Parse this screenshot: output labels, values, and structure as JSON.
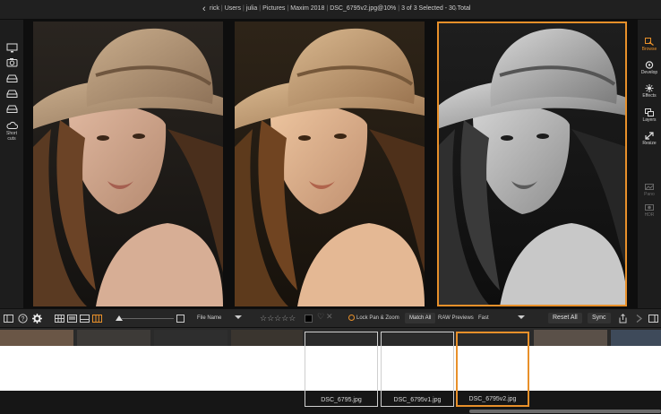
{
  "titlebar": {
    "back": "‹",
    "forward": "›",
    "crumbs": [
      "rick",
      "Users",
      "julia",
      "Pictures",
      "Maxim 2018",
      "DSC_6795v2.jpg@10%"
    ],
    "selection": "3 of 3 Selected - 30 Total"
  },
  "left_rail": {
    "icons": [
      "monitor-icon",
      "camera-icon",
      "drive-icon",
      "drive-icon",
      "drive-icon",
      "cloud-icon"
    ],
    "shortcuts_label": "Short cuts"
  },
  "right_rail": {
    "items": [
      {
        "label": "Browse",
        "icon": "browse-icon"
      },
      {
        "label": "Develop",
        "icon": "develop-icon"
      },
      {
        "label": "Effects",
        "icon": "effects-icon"
      },
      {
        "label": "Layers",
        "icon": "layers-icon"
      },
      {
        "label": "Resize",
        "icon": "resize-icon"
      },
      {
        "label": "Pano",
        "icon": "pano-icon"
      },
      {
        "label": "HDR",
        "icon": "hdr-icon"
      }
    ],
    "accent": "#e8902a"
  },
  "toolbar": {
    "sort_label": "File Name",
    "stars": "☆☆☆☆☆",
    "lock_pan_zoom": "Lock Pan & Zoom",
    "match_all": "Match All",
    "raw_previews_label": "RAW Previews",
    "raw_previews_value": "Fast",
    "reset_all": "Reset All",
    "sync": "Sync"
  },
  "filmstrip": {
    "items": [
      {
        "name": "DSC_6795.jpg",
        "selected": false
      },
      {
        "name": "DSC_6795v1.jpg",
        "selected": false
      },
      {
        "name": "DSC_6795v2.jpg",
        "selected": true
      }
    ]
  }
}
